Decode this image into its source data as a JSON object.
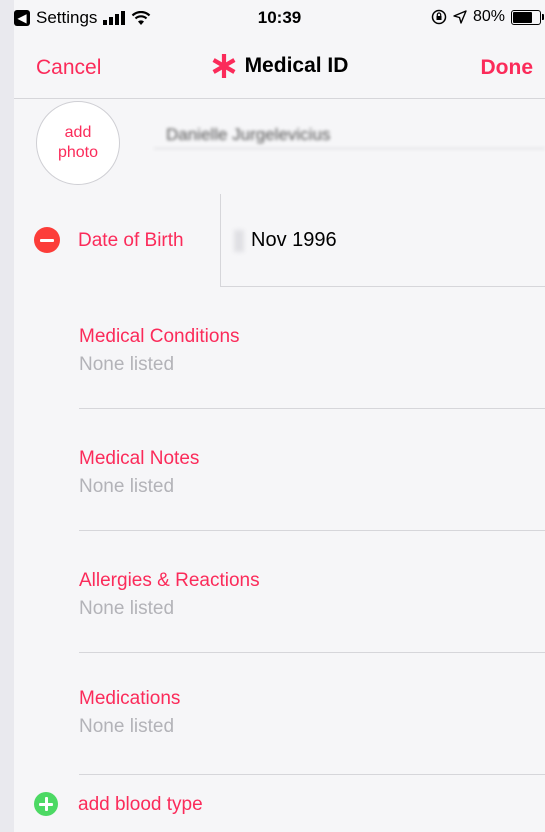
{
  "status_bar": {
    "back_app": "Settings",
    "time": "10:39",
    "battery_text": "80%",
    "battery_level": 0.8,
    "icons": [
      "back-arrow-icon",
      "signal-icon",
      "wifi-icon",
      "orientation-lock-icon",
      "location-icon",
      "battery-icon"
    ]
  },
  "nav": {
    "cancel_label": "Cancel",
    "title": "Medical ID",
    "done_label": "Done",
    "title_icon": "asterisk-icon"
  },
  "profile": {
    "add_photo_line1": "add",
    "add_photo_line2": "photo",
    "name_value": "Danielle Jurgelevicius"
  },
  "dob": {
    "label": "Date of Birth",
    "value": "Nov 1996"
  },
  "sections": [
    {
      "title": "Medical Conditions",
      "placeholder": "None listed"
    },
    {
      "title": "Medical Notes",
      "placeholder": "None listed"
    },
    {
      "title": "Allergies & Reactions",
      "placeholder": "None listed"
    },
    {
      "title": "Medications",
      "placeholder": "None listed"
    }
  ],
  "add_blood_type": {
    "label": "add blood type"
  },
  "colors": {
    "accent": "#fb2b5a",
    "remove_red": "#fc3d39",
    "add_green": "#4cd964",
    "placeholder_gray": "#b3b3b8"
  }
}
